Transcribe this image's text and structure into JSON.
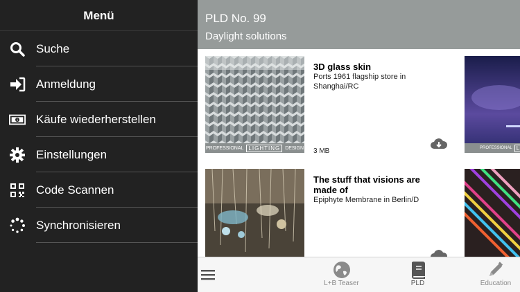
{
  "menu": {
    "title": "Menü",
    "items": [
      {
        "label": "Suche",
        "icon": "search-icon"
      },
      {
        "label": "Anmeldung",
        "icon": "sign-in-icon"
      },
      {
        "label": "Käufe wiederherstellen",
        "icon": "money-icon"
      },
      {
        "label": "Einstellungen",
        "icon": "gear-icon"
      },
      {
        "label": "Code Scannen",
        "icon": "qr-code-icon"
      },
      {
        "label": "Synchronisieren",
        "icon": "spinner-icon"
      }
    ]
  },
  "header": {
    "title": "PLD No. 99",
    "subtitle": "Daylight solutions"
  },
  "articles": [
    {
      "title": "3D glass skin",
      "description": "Ports 1961 flagship store in Shanghai/RC",
      "size": "3 MB",
      "cover_band_left": "PROFESSIONAL",
      "cover_band_big": "LIGHTING",
      "cover_band_right": "DESIGN"
    },
    {
      "title": "The stuff that visions are made of",
      "description": "Epiphyte Membrane in Berlin/D",
      "size": ""
    }
  ],
  "peek_band": {
    "left": "PROFESSIONAL",
    "big": "LIGHTI"
  },
  "tabbar": {
    "tabs": [
      {
        "label": "",
        "icon": "hamburger-icon"
      },
      {
        "label": "L+B Teaser",
        "icon": "globe-icon"
      },
      {
        "label": "PLD",
        "icon": "book-icon",
        "active": true
      },
      {
        "label": "Education",
        "icon": "pencil-icon"
      }
    ]
  },
  "colors": {
    "menu_bg": "#222222",
    "header_bg": "#969b9a",
    "tabbar_bg": "#f6f6f6"
  }
}
